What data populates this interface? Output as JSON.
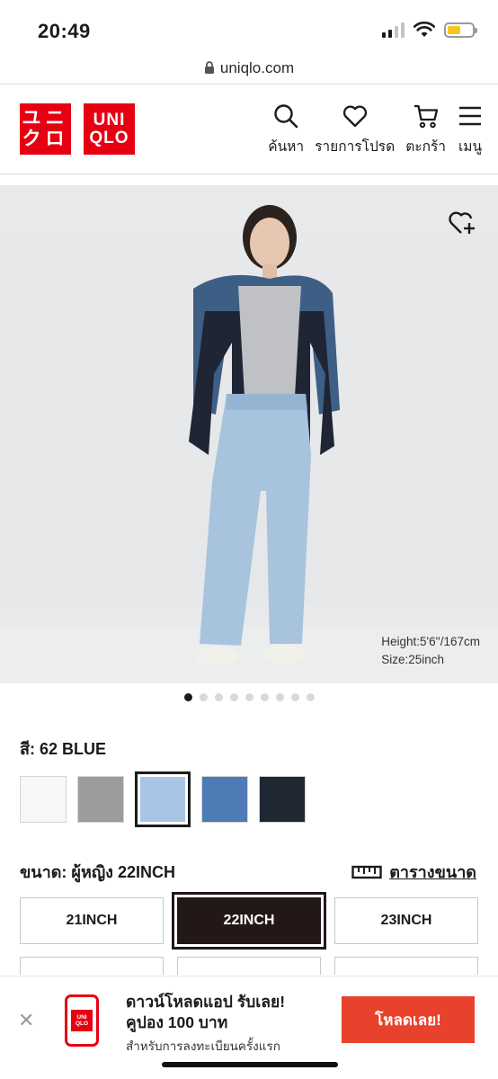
{
  "status_bar": {
    "time": "20:49"
  },
  "browser": {
    "url": "uniqlo.com"
  },
  "header": {
    "logo_katakana": [
      "ユニ",
      "クロ"
    ],
    "logo_latin": [
      "UNI",
      "QLO"
    ],
    "nav": [
      {
        "label": "ค้นหา",
        "icon": "search-icon"
      },
      {
        "label": "รายการโปรด",
        "icon": "heart-icon"
      },
      {
        "label": "ตะกร้า",
        "icon": "cart-icon"
      },
      {
        "label": "เมนู",
        "icon": "menu-icon"
      }
    ]
  },
  "product_image": {
    "caption_height": "Height:5'6''/167cm",
    "caption_size": "Size:25inch",
    "wishlist_icon": "heart-plus-icon",
    "dots_total": 9,
    "dots_active": 1
  },
  "color": {
    "label": "สี: 62 BLUE",
    "swatches": [
      {
        "name": "white",
        "color": "#f7f7f5"
      },
      {
        "name": "gray",
        "color": "#9c9c9c"
      },
      {
        "name": "light-blue",
        "color": "#a9c5e6",
        "selected": true
      },
      {
        "name": "blue",
        "color": "#4e7bb5"
      },
      {
        "name": "navy",
        "color": "#1f2733"
      }
    ]
  },
  "size": {
    "label": "ขนาด: ผู้หญิง 22INCH",
    "chart_link": "ตารางขนาด",
    "options": [
      "21INCH",
      "22INCH",
      "23INCH"
    ],
    "selected": "22INCH"
  },
  "app_banner": {
    "title_line1": "ดาวน์โหลดแอป รับเลย!",
    "title_line2": "คูปอง 100 บาท",
    "subtitle": "สำหรับการลงทะเบียนครั้งแรก",
    "cta": "โหลดเลย!",
    "logo_text": [
      "UNI",
      "QLO"
    ]
  }
}
